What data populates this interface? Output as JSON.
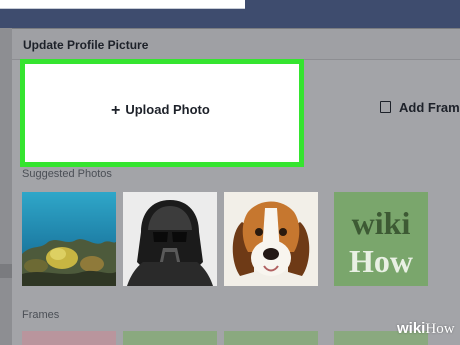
{
  "dialog": {
    "title": "Update Profile Picture",
    "upload_label": "Upload Photo",
    "add_frame_label": "Add Fram",
    "suggested_label": "Suggested Photos",
    "frames_label": "Frames"
  },
  "suggested_photos": [
    {
      "name": "coral-reef-photo"
    },
    {
      "name": "darth-vader-photo"
    },
    {
      "name": "beagle-dog-photo"
    },
    {
      "name": "wikihow-logo-photo",
      "line1": "wiki",
      "line2": "How"
    }
  ],
  "watermark": {
    "bold": "wiki",
    "light": "How"
  },
  "colors": {
    "highlight": "#35e42f",
    "topbar": "#3e4c6e",
    "wikihow_green": "#7aa66c"
  }
}
